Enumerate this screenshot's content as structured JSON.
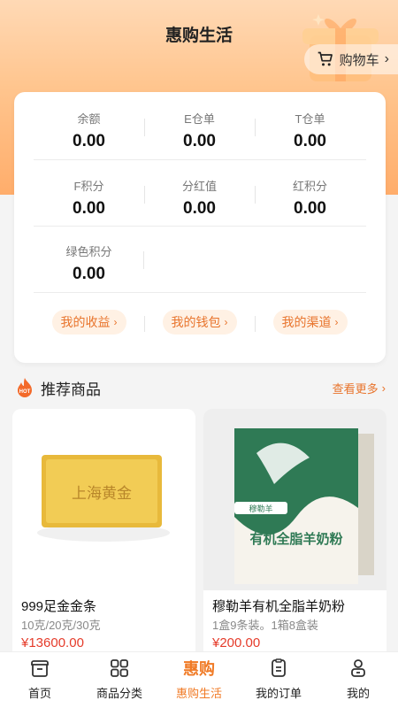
{
  "header": {
    "title": "惠购生活",
    "cart_label": "购物车"
  },
  "stats": {
    "row1": [
      {
        "label": "余额",
        "value": "0.00"
      },
      {
        "label": "E仓单",
        "value": "0.00"
      },
      {
        "label": "T仓单",
        "value": "0.00"
      }
    ],
    "row2": [
      {
        "label": "F积分",
        "value": "0.00"
      },
      {
        "label": "分红值",
        "value": "0.00"
      },
      {
        "label": "红积分",
        "value": "0.00"
      }
    ],
    "row3": [
      {
        "label": "绿色积分",
        "value": "0.00"
      }
    ]
  },
  "links": [
    "我的收益",
    "我的钱包",
    "我的渠道"
  ],
  "recommend": {
    "title": "推荐商品",
    "more_label": "查看更多",
    "hot_badge": "HOT"
  },
  "products": [
    {
      "name": "999足金金条",
      "desc": "10克/20克/30克",
      "price": "¥13600.00",
      "image_text": "上海黄金"
    },
    {
      "name": "穆勒羊有机全脂羊奶粉",
      "desc": "1盒9条装。1箱8盒装",
      "price": "¥200.00",
      "image_text": "有机全脂羊奶粉",
      "image_brand": "穆勒羊"
    }
  ],
  "tabs": [
    {
      "label": "首页",
      "icon": "home-icon"
    },
    {
      "label": "商品分类",
      "icon": "category-icon"
    },
    {
      "label": "惠购生活",
      "icon": "brand-logo",
      "brand": "惠购",
      "active": true
    },
    {
      "label": "我的订单",
      "icon": "order-icon"
    },
    {
      "label": "我的",
      "icon": "user-icon"
    }
  ],
  "colors": {
    "accent": "#f07a25",
    "price": "#e53b2a",
    "header": "#ffc58e"
  }
}
